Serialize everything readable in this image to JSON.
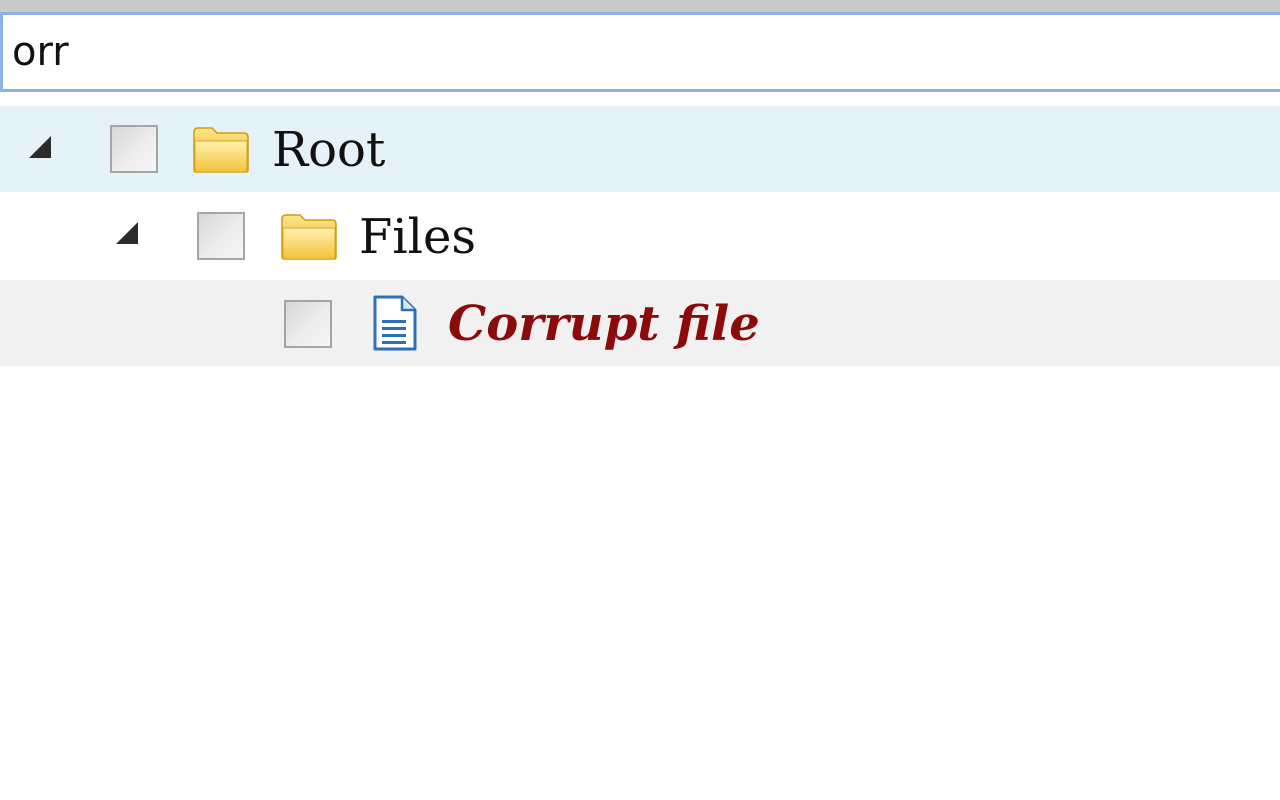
{
  "search": {
    "value": "orr",
    "placeholder": ""
  },
  "tree": {
    "nodes": [
      {
        "label": "Root",
        "icon": "folder-icon",
        "expanded": true,
        "checked": false,
        "highlighted": true
      },
      {
        "label": "Files",
        "icon": "folder-icon",
        "expanded": true,
        "checked": false
      },
      {
        "label": "Corrupt file",
        "icon": "document-icon",
        "checked": false,
        "style": "error"
      }
    ]
  },
  "colors": {
    "search_border": "#8cb0e8",
    "selected_row": "#e6f2fa",
    "hover_row": "#f1f1f1",
    "error_text": "#8b0a0a",
    "folder": "#f5c842",
    "document": "#2a6fb8"
  }
}
